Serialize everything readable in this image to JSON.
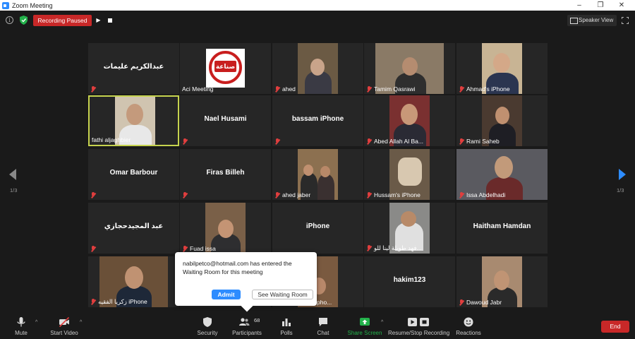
{
  "window": {
    "title": "Zoom Meeting",
    "controls": [
      "–",
      "❐",
      "✕"
    ]
  },
  "topbar": {
    "recording_label": "Recording Paused",
    "speaker_view_label": "Speaker View"
  },
  "colors": {
    "recording_red": "#c82828",
    "active_speaker": "#c6d34e",
    "admit_blue": "#2d8cff",
    "muted_red": "#e03e3e",
    "share_green": "#23b24b"
  },
  "pagination": {
    "left": "1/3",
    "right": "1/3"
  },
  "tiles": [
    {
      "name": "عبدالكريم عليمات",
      "video": false
    },
    {
      "name": "Aci Meeting",
      "video": true
    },
    {
      "name": "ahed",
      "video": true
    },
    {
      "name": "Tamim Qasrawi",
      "video": true
    },
    {
      "name": "Ahmad's iPhone",
      "video": true
    },
    {
      "name": "fathi aljaghbier",
      "video": true,
      "active": true
    },
    {
      "name": "Nael Husami",
      "video": false
    },
    {
      "name": "bassam iPhone",
      "video": false
    },
    {
      "name": "Abed Allah Al Ba...",
      "video": true
    },
    {
      "name": "Rami Saheb",
      "video": true
    },
    {
      "name": "Omar Barbour",
      "video": false
    },
    {
      "name": "Firas Billeh",
      "video": false
    },
    {
      "name": "ahed jaber",
      "video": true
    },
    {
      "name": "Hussam's iPhone",
      "video": true
    },
    {
      "name": "Issa Abdelhadi",
      "video": true
    },
    {
      "name": "عبد المجيدحجازي",
      "video": false
    },
    {
      "name": "Fuad issa",
      "video": true
    },
    {
      "name": "iPhone",
      "video": false
    },
    {
      "name": "فهد طويلة لينا للو...",
      "video": true
    },
    {
      "name": "Haitham Hamdan",
      "video": false
    },
    {
      "name": "زكريا الفقيه iPhone",
      "video": true
    },
    {
      "name": "pho...",
      "video": true
    },
    {
      "name": "hakim123",
      "video": false
    },
    {
      "name": "Dawoud Jabr",
      "video": true
    }
  ],
  "popup": {
    "message": "nabilpetco@hotmail.com has entered the Waiting Room for this meeting",
    "admit_label": "Admit",
    "waiting_room_label": "See Waiting Room"
  },
  "toolbar": {
    "mute": "Mute",
    "start_video": "Start Video",
    "security": "Security",
    "participants": "Participants",
    "participants_count": "68",
    "polls": "Polls",
    "chat": "Chat",
    "share_screen": "Share Screen",
    "record": "Resume/Stop Recording",
    "reactions": "Reactions",
    "end": "End"
  },
  "icons": [
    "info-icon",
    "shield-icon",
    "play-icon",
    "stop-icon",
    "speaker-view-icon",
    "fullscreen-icon",
    "mic-muted-icon",
    "mic-icon",
    "video-off-icon",
    "people-icon",
    "poll-icon",
    "chat-icon",
    "share-icon",
    "record-icon",
    "emoji-icon",
    "arrow-left-icon",
    "arrow-right-icon"
  ]
}
